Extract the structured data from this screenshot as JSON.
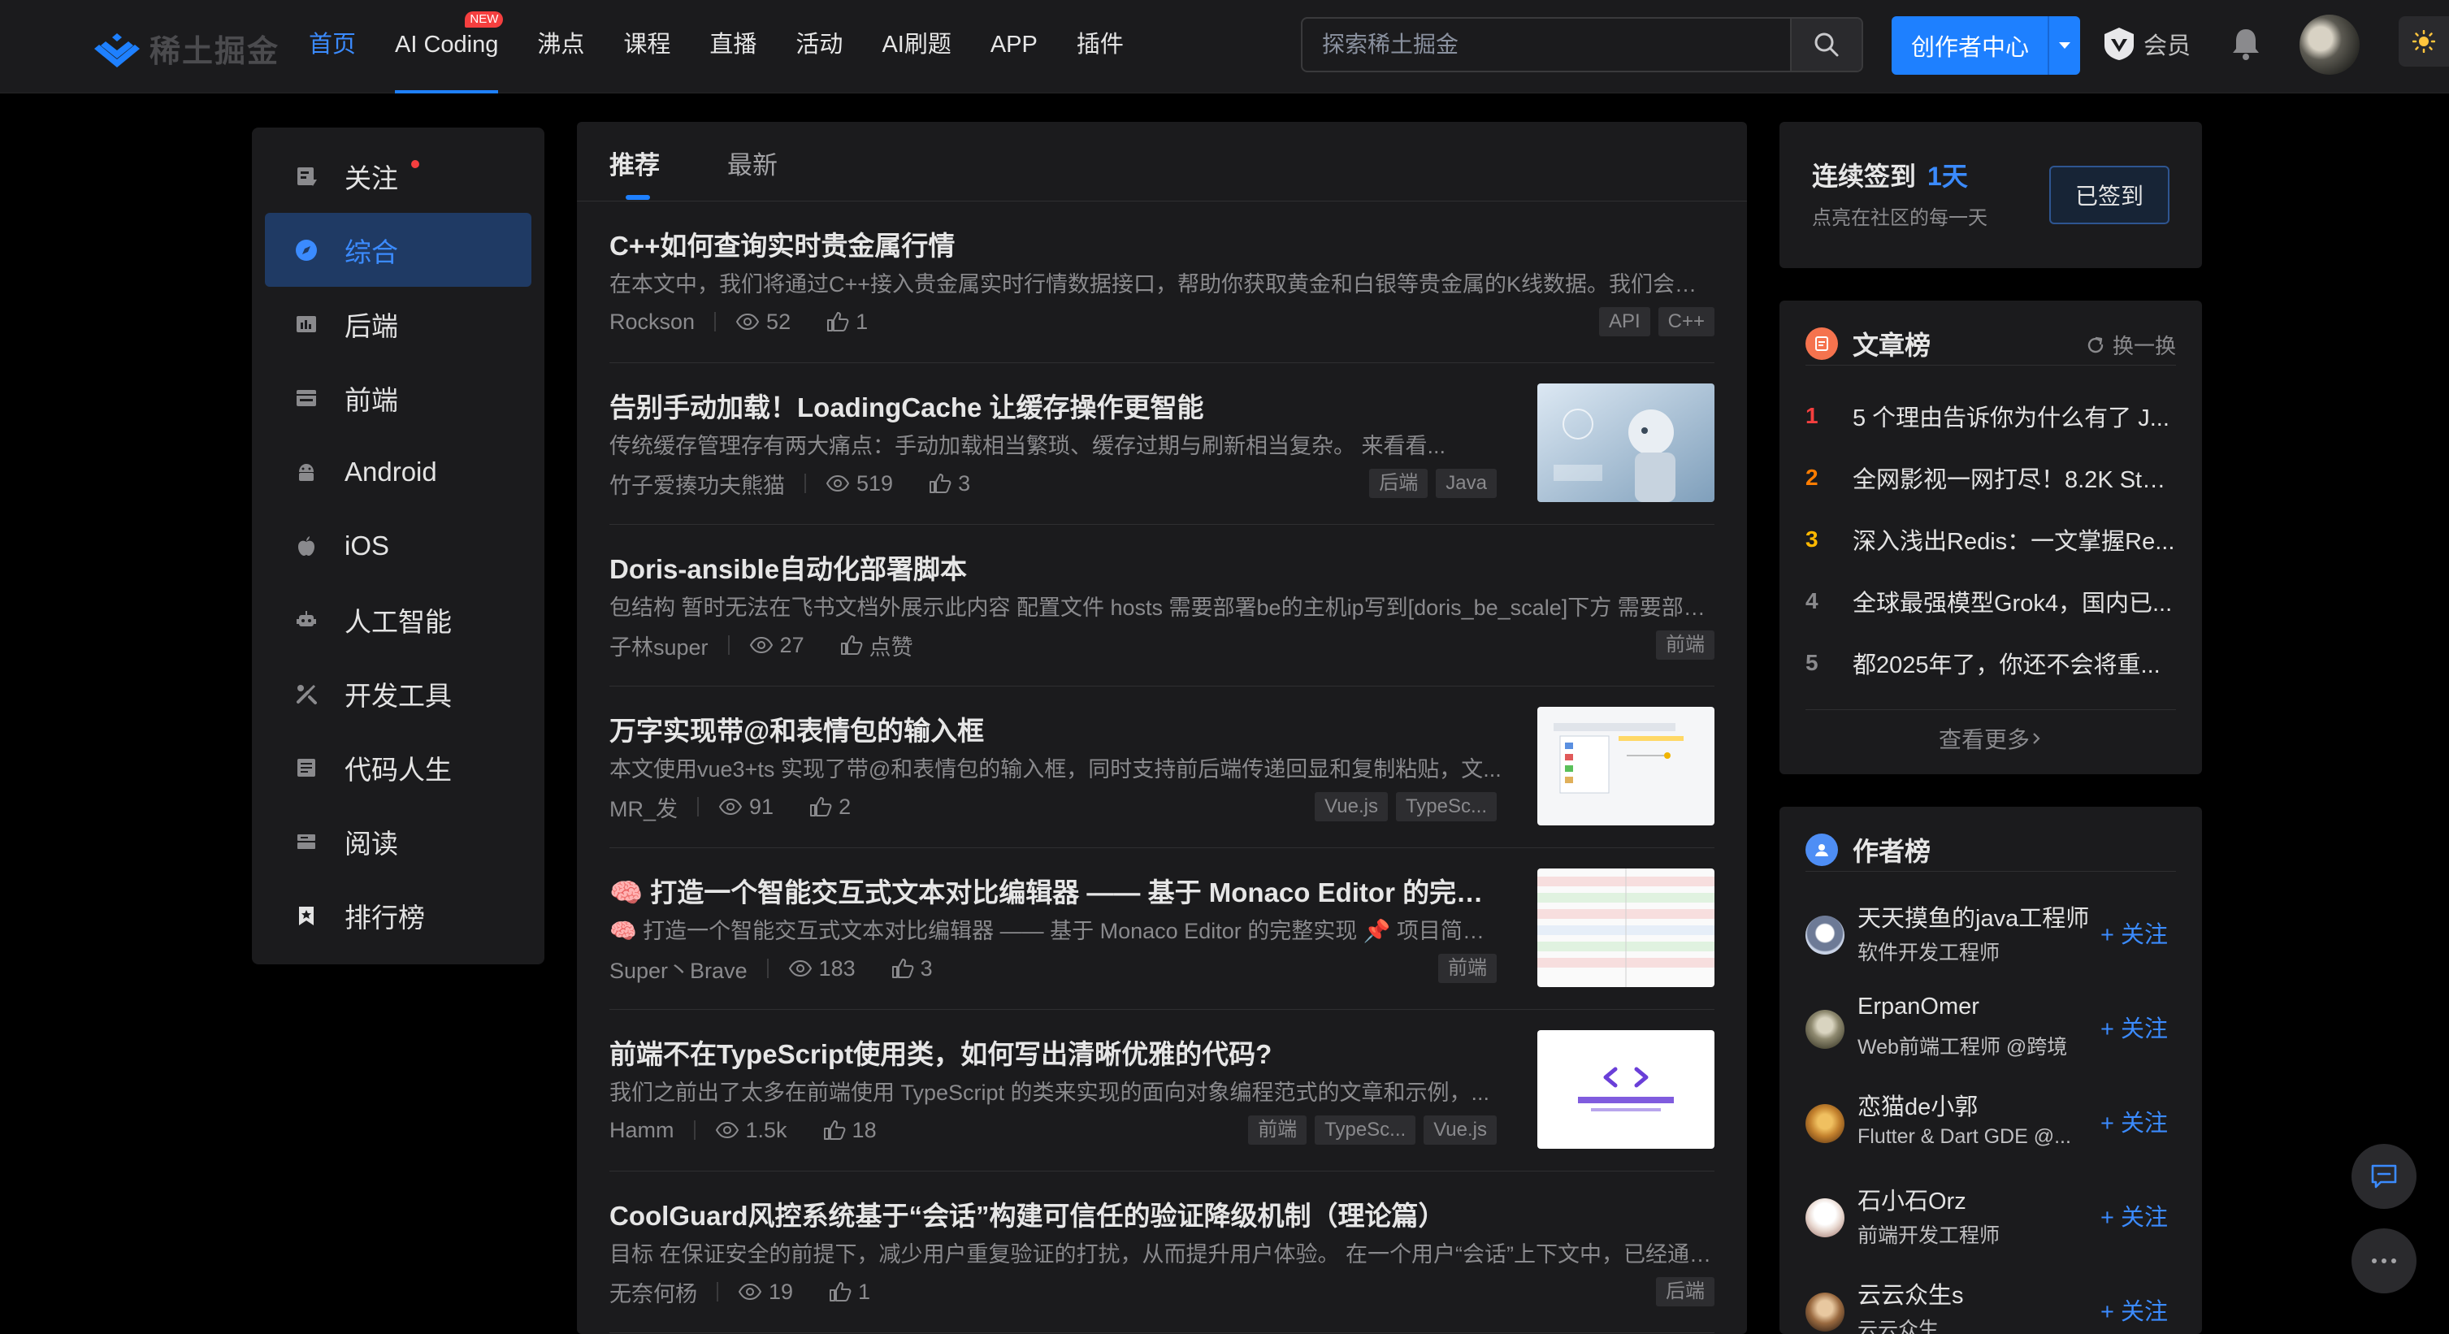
{
  "header": {
    "logo_text": "稀土掘金",
    "nav": [
      {
        "label": "首页",
        "active": true
      },
      {
        "label": "AI Coding",
        "badge": "NEW"
      },
      {
        "label": "沸点"
      },
      {
        "label": "课程"
      },
      {
        "label": "直播"
      },
      {
        "label": "活动"
      },
      {
        "label": "AI刷题"
      },
      {
        "label": "APP"
      },
      {
        "label": "插件"
      }
    ],
    "search_placeholder": "探索稀土掘金",
    "creator_label": "创作者中心",
    "vip_label": "会员",
    "accent": "#1e80ff"
  },
  "sidebar": {
    "items": [
      {
        "label": "关注",
        "icon": "follow-icon",
        "dot": true
      },
      {
        "label": "综合",
        "icon": "compass-icon",
        "active": true
      },
      {
        "label": "后端",
        "icon": "backend-icon"
      },
      {
        "label": "前端",
        "icon": "frontend-icon"
      },
      {
        "label": "Android",
        "icon": "android-icon"
      },
      {
        "label": "iOS",
        "icon": "apple-icon"
      },
      {
        "label": "人工智能",
        "icon": "robot-icon"
      },
      {
        "label": "开发工具",
        "icon": "tools-icon"
      },
      {
        "label": "代码人生",
        "icon": "code-life-icon"
      },
      {
        "label": "阅读",
        "icon": "book-icon"
      },
      {
        "label": "排行榜",
        "icon": "ranking-icon"
      }
    ]
  },
  "feed": {
    "tabs": [
      "推荐",
      "最新"
    ],
    "articles": [
      {
        "title": "C++如何查询实时贵金属行情",
        "desc": "在本文中，我们将通过C++接入贵金属实时行情数据接口，帮助你获取黄金和白银等贵金属的K线数据。我们会使用...",
        "author": "Rockson",
        "views": "52",
        "likes": "1",
        "tags": [
          "API",
          "C++"
        ],
        "thumb": null
      },
      {
        "title": "告别手动加载！LoadingCache 让缓存操作更智能",
        "desc": "传统缓存管理存有两大痛点：手动加载相当繁琐、缓存过期与刷新相当复杂。 来看看...",
        "author": "竹子爱揍功夫熊猫",
        "views": "519",
        "likes": "3",
        "tags": [
          "后端",
          "Java"
        ],
        "thumb": "robot"
      },
      {
        "title": "Doris-ansible自动化部署脚本",
        "desc": "包结构 暂时无法在飞书文档外展示此内容 配置文件 hosts 需要部署be的主机ip写到[doris_be_scale]下方 需要部署...",
        "author": "子林super",
        "views": "27",
        "likes": "点赞",
        "tags": [
          "前端"
        ],
        "thumb": null
      },
      {
        "title": "万字实现带@和表情包的输入框",
        "desc": "本文使用vue3+ts 实现了带@和表情包的输入框，同时支持前后端传递回显和复制粘贴，文...",
        "author": "MR_发",
        "views": "91",
        "likes": "2",
        "tags": [
          "Vue.js",
          "TypeSc..."
        ],
        "thumb": "ui"
      },
      {
        "title": "🧠 打造一个智能交互式文本对比编辑器 —— 基于 Monaco Editor 的完整...",
        "desc": "🧠 打造一个智能交互式文本对比编辑器 —— 基于 Monaco Editor 的完整实现 📌 项目简介 ...",
        "author": "Super丶Brave",
        "views": "183",
        "likes": "3",
        "tags": [
          "前端"
        ],
        "thumb": "diff"
      },
      {
        "title": "前端不在TypeScript使用类，如何写出清晰优雅的代码?",
        "desc": "我们之前出了太多在前端使用 TypeScript 的类来实现的面向对象编程范式的文章和示例，...",
        "author": "Hamm",
        "views": "1.5k",
        "likes": "18",
        "tags": [
          "前端",
          "TypeSc...",
          "Vue.js"
        ],
        "thumb": "ts"
      },
      {
        "title": "CoolGuard风控系统基于“会话”构建可信任的验证降级机制（理论篇）",
        "desc": "目标 在保证安全的前提下，减少用户重复验证的打扰，从而提升用户体验。 在一个用户“会话”上下文中，已经通过...",
        "author": "无奈何杨",
        "views": "19",
        "likes": "1",
        "tags": [
          "后端"
        ],
        "thumb": null
      }
    ]
  },
  "signin": {
    "title": "连续签到",
    "days": "1天",
    "subtitle": "点亮在社区的每一天",
    "button": "已签到"
  },
  "article_rank": {
    "title": "文章榜",
    "refresh": "换一换",
    "items": [
      {
        "rank": "1",
        "text": "5 个理由告诉你为什么有了 J...",
        "color": "#f53f3f"
      },
      {
        "rank": "2",
        "text": "全网影视一网打尽！8.2K Star...",
        "color": "#ff7d00"
      },
      {
        "rank": "3",
        "text": "深入浅出Redis：一文掌握Re...",
        "color": "#ffb800"
      },
      {
        "rank": "4",
        "text": "全球最强模型Grok4，国内已...",
        "color": "#8a8a8d"
      },
      {
        "rank": "5",
        "text": "都2025年了，你还不会将重...",
        "color": "#8a8a8d"
      }
    ],
    "see_more": "查看更多"
  },
  "author_rank": {
    "title": "作者榜",
    "follow_label": "+ 关注",
    "items": [
      {
        "name": "天天摸鱼的java工程师",
        "role": "软件开发工程师"
      },
      {
        "name": "ErpanOmer",
        "role": "Web前端工程师 @跨境"
      },
      {
        "name": "恋猫de小郭",
        "role": "Flutter & Dart GDE @..."
      },
      {
        "name": "石小石Orz",
        "role": "前端开发工程师"
      },
      {
        "name": "云云众生s",
        "role": "云云众生"
      }
    ]
  }
}
